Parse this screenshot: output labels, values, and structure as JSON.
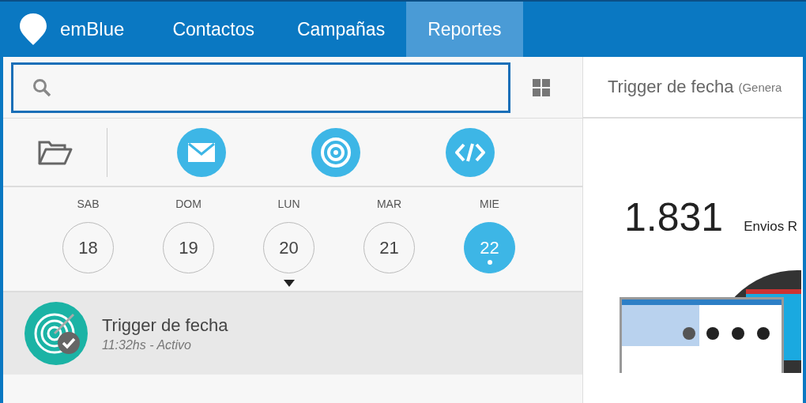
{
  "brand": {
    "name": "emBlue"
  },
  "nav": [
    {
      "label": "Contactos",
      "selected": false
    },
    {
      "label": "Campañas",
      "selected": false
    },
    {
      "label": "Reportes",
      "selected": true
    }
  ],
  "categories": [
    {
      "kind": "folder"
    },
    {
      "kind": "email"
    },
    {
      "kind": "target"
    },
    {
      "kind": "code"
    }
  ],
  "days": [
    {
      "weekday": "SAB",
      "day": "18",
      "selected": false,
      "pointer": false,
      "today": false
    },
    {
      "weekday": "DOM",
      "day": "19",
      "selected": false,
      "pointer": false,
      "today": false
    },
    {
      "weekday": "LUN",
      "day": "20",
      "selected": false,
      "pointer": true,
      "today": false
    },
    {
      "weekday": "MAR",
      "day": "21",
      "selected": false,
      "pointer": false,
      "today": false
    },
    {
      "weekday": "MIE",
      "day": "22",
      "selected": true,
      "pointer": false,
      "today": true
    }
  ],
  "campaigns": [
    {
      "title": "Trigger de fecha",
      "subtitle": "11:32hs - Activo",
      "selected": true
    }
  ],
  "report": {
    "title": "Trigger de fecha",
    "title_note": "(Genera",
    "metric_value": "1.831",
    "metric_label": "Envios R"
  }
}
